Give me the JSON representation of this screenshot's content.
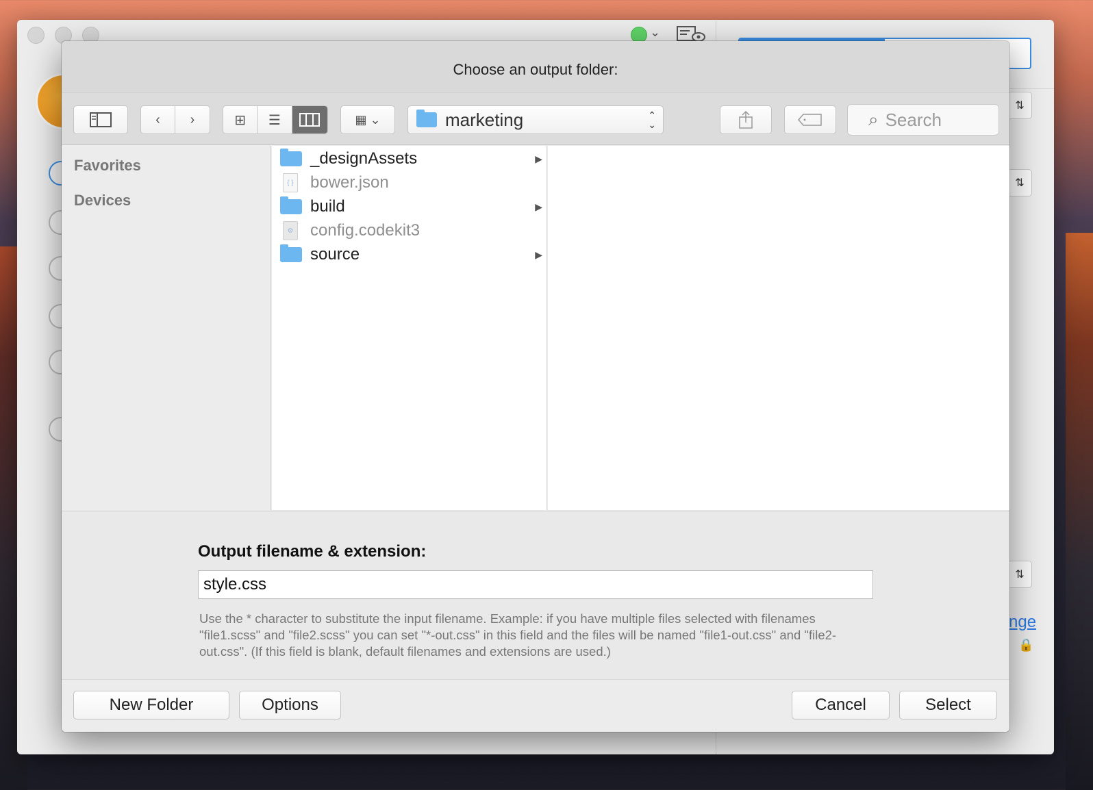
{
  "dialog": {
    "title": "Choose an output folder:"
  },
  "toolbar": {
    "sidebar_toggle_icon": "sidebar-icon",
    "back_icon": "chevron-left-icon",
    "forward_icon": "chevron-right-icon",
    "view_icons": [
      "icon-view-icon",
      "list-view-icon",
      "column-view-icon"
    ],
    "selected_view": "column-view",
    "arrange_icon": "arrange-grid-icon",
    "path": "marketing",
    "share_icon": "share-icon",
    "tag_icon": "tag-icon",
    "search_placeholder": "Search"
  },
  "sidebar": {
    "sections": [
      "Favorites",
      "Devices"
    ]
  },
  "files": [
    {
      "name": "_designAssets",
      "type": "folder",
      "enabled": true,
      "has_children": true
    },
    {
      "name": "bower.json",
      "type": "json",
      "enabled": false,
      "has_children": false
    },
    {
      "name": "build",
      "type": "folder",
      "enabled": true,
      "has_children": true
    },
    {
      "name": "config.codekit3",
      "type": "config",
      "enabled": false,
      "has_children": false
    },
    {
      "name": "source",
      "type": "folder",
      "enabled": true,
      "has_children": true
    }
  ],
  "accessory": {
    "label": "Output filename & extension:",
    "value": "style.css",
    "help": "Use the * character to substitute the input filename. Example: if you have multiple files selected with filenames \"file1.scss\" and \"file2.scss\" you can set \"*-out.css\" in this field and the files will be named \"file1-out.css\" and \"file2-out.css\". (If this field is blank, default filenames and extensions are used.)"
  },
  "footer": {
    "new_folder": "New Folder",
    "options": "Options",
    "cancel": "Cancel",
    "select": "Select"
  },
  "background": {
    "link_fragment": "nge",
    "colors": {
      "status_green": "#5fd468",
      "accent_blue": "#3a8de2",
      "folder_blue": "#6cb7f0",
      "logo_orange": "#f7b035"
    }
  }
}
